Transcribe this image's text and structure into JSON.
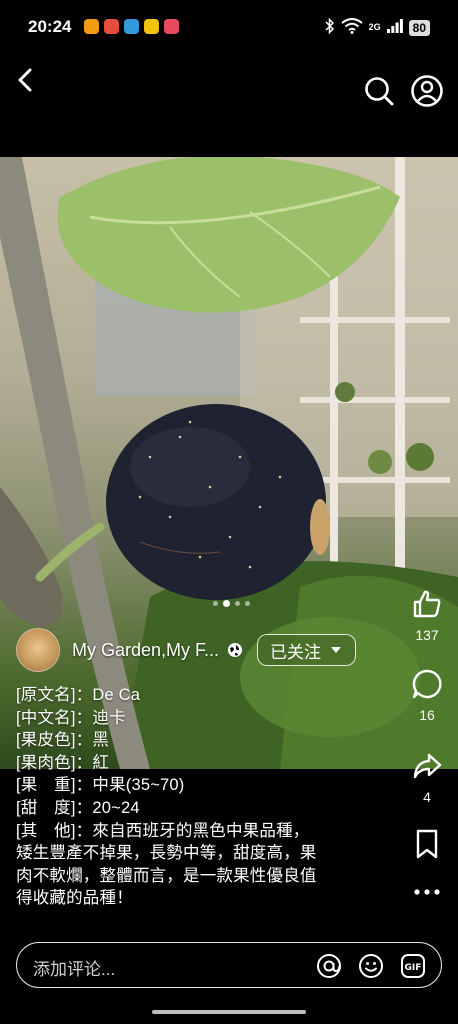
{
  "status_bar": {
    "time": "20:24",
    "network": "2G",
    "battery": "80",
    "app_colors": [
      "#f39c12",
      "#e74c3c",
      "#3498db",
      "#f1c40f",
      "#e84a5f"
    ]
  },
  "author": {
    "name": "My Garden,My F...",
    "follow_label": "已关注"
  },
  "carousel": {
    "total": 4,
    "active": 2
  },
  "actions": {
    "likes": "137",
    "comments": "16",
    "shares": "4"
  },
  "description": {
    "lines": [
      "[原文名]：De Ca",
      "[中文名]：迪卡",
      "[果皮色]：黑",
      "[果肉色]：紅",
      "[果　重]：中果(35~70)",
      "[甜　度]：20~24",
      "[其　他]：來自西班牙的黑色中果品種，",
      "矮生豐產不掉果，長勢中等，甜度高，果",
      "肉不軟爛，整體而言，是一款果性優良值",
      "得收藏的品種！"
    ]
  },
  "comment_bar": {
    "placeholder": "添加评论..."
  },
  "colors": {
    "background": "#000000",
    "fig": "#1f2230",
    "leaf": "#9cc06a"
  }
}
